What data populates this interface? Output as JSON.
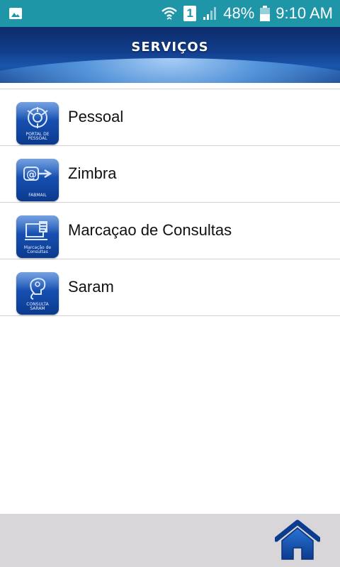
{
  "status_bar": {
    "battery": "48%",
    "time": "9:10 AM",
    "sim": "1",
    "icons": [
      "image-icon",
      "wifi-icon",
      "sim-icon",
      "signal-icon",
      "battery-icon"
    ]
  },
  "header": {
    "title": "SERVIÇOS"
  },
  "services": [
    {
      "label": "Pessoal",
      "icon": "portal-de-pessoal-icon",
      "caption_line1": "PORTAL DE",
      "caption_line2": "PESSOAL"
    },
    {
      "label": "Zimbra",
      "icon": "fabmail-icon",
      "caption_line1": "FABMAIL",
      "caption_line2": ""
    },
    {
      "label": "Marcaçao de Consultas",
      "icon": "marcacao-de-consultas-icon",
      "caption_line1": "Marcação de",
      "caption_line2": "Consultas"
    },
    {
      "label": "Saram",
      "icon": "consulta-saram-icon",
      "caption_line1": "CONSULTA",
      "caption_line2": "SARAM"
    }
  ],
  "bottom_bar": {
    "icon": "home-icon"
  },
  "colors": {
    "status_bar": "#1e96a8",
    "header": "#123f8c",
    "tile": "#164fb0",
    "bottom_bar": "#d8d6d8",
    "home": "#0e4aa6"
  }
}
